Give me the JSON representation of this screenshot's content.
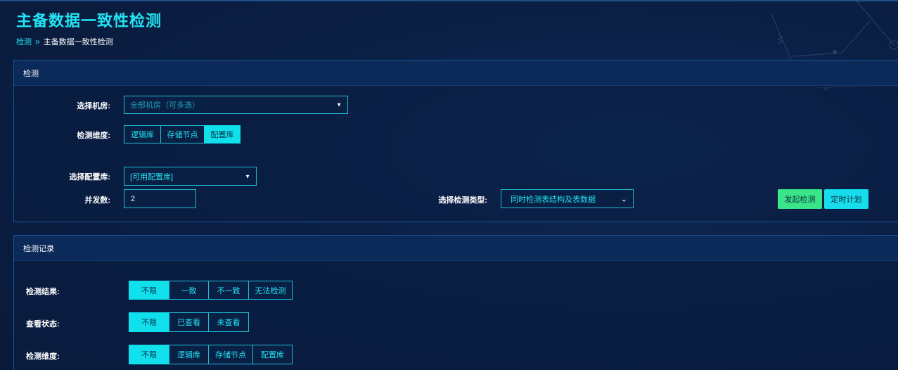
{
  "page": {
    "title": "主备数据一致性检测",
    "breadcrumb": {
      "root": "检测",
      "separator": "»",
      "current": "主备数据一致性检测"
    }
  },
  "detect_panel": {
    "header": "检测",
    "room": {
      "label": "选择机房:",
      "placeholder": "全部机房（可多选）"
    },
    "dimension": {
      "label": "检测维度:",
      "options": [
        "逻辑库",
        "存储节点",
        "配置库"
      ],
      "selected": "配置库"
    },
    "config_db": {
      "label": "选择配置库:",
      "value": "[可用配置库]"
    },
    "concurrency": {
      "label": "并发数:",
      "value": "2"
    },
    "check_type": {
      "label": "选择检测类型:",
      "value": "同时检测表结构及表数据"
    },
    "start_button": "发起检测",
    "schedule_button": "定时计划"
  },
  "records_panel": {
    "header": "检测记录",
    "result": {
      "label": "检测结果:",
      "options": [
        "不限",
        "一致",
        "不一致",
        "无法检测"
      ],
      "selected": "不限"
    },
    "view_status": {
      "label": "查看状态:",
      "options": [
        "不限",
        "已查看",
        "未查看"
      ],
      "selected": "不限"
    },
    "dimension": {
      "label": "检测维度:",
      "options": [
        "不限",
        "逻辑库",
        "存储节点",
        "配置库"
      ],
      "selected": "不限"
    }
  },
  "colors": {
    "accent": "#22e3f2",
    "selected_segment": "#10e0ec",
    "start_button": "#3ae58a",
    "schedule_button": "#16dcec",
    "background": "#0b1f44"
  }
}
